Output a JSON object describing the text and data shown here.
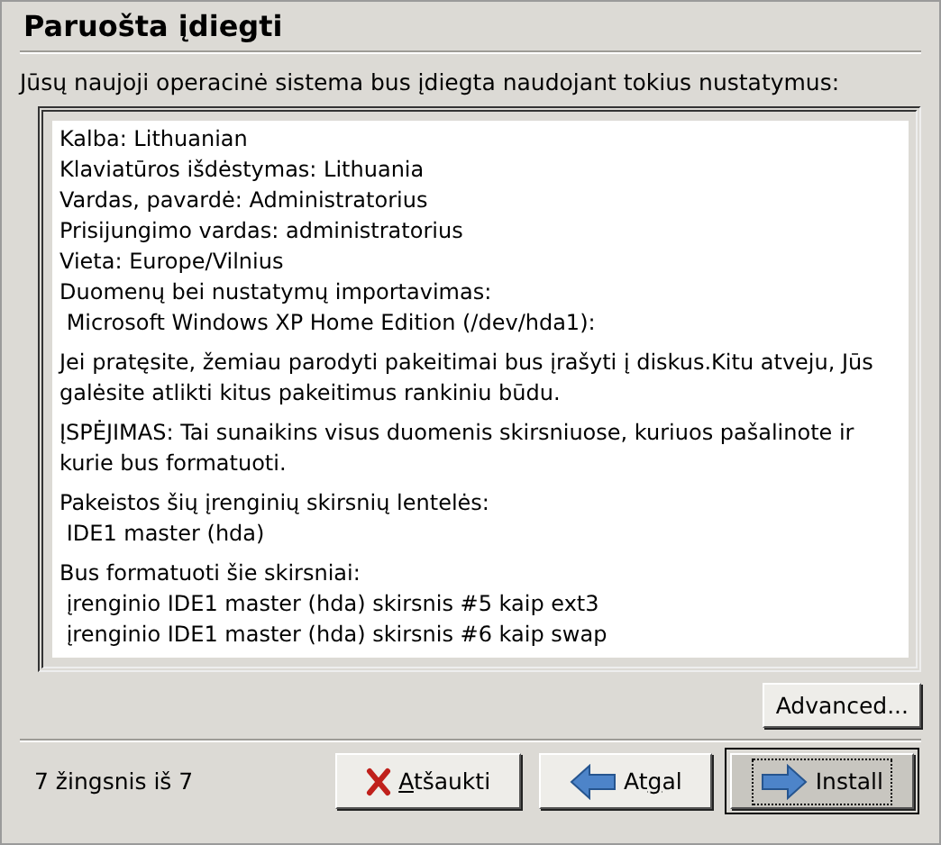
{
  "title": "Paruošta įdiegti",
  "intro": "Jūsų naujoji operacinė sistema bus įdiegta naudojant tokius nustatymus:",
  "summary": [
    {
      "lines": [
        "Kalba: Lithuanian",
        "Klaviatūros išdėstymas: Lithuania",
        "Vardas, pavardė: Administratorius",
        "Prisijungimo vardas: administratorius",
        "Vieta: Europe/Vilnius",
        "Duomenų bei nustatymų importavimas:",
        " Microsoft Windows XP Home Edition (/dev/hda1):"
      ]
    },
    {
      "lines": [
        "Jei pratęsite, žemiau parodyti pakeitimai bus įrašyti į diskus.Kitu atveju, Jūs galėsite atlikti kitus pakeitimus rankiniu būdu."
      ]
    },
    {
      "lines": [
        "ĮSPĖJIMAS: Tai sunaikins visus duomenis skirsniuose, kuriuos pašalinote ir kurie bus formatuoti."
      ]
    },
    {
      "lines": [
        "Pakeistos šių įrenginių skirsnių lentelės:",
        " IDE1 master (hda)"
      ]
    },
    {
      "lines": [
        "Bus formatuoti šie skirsniai:",
        " įrenginio IDE1 master (hda) skirsnis #5 kaip ext3",
        " įrenginio IDE1 master (hda) skirsnis #6 kaip swap"
      ]
    }
  ],
  "advanced_button": "Advanced...",
  "step": "7 žingsnis iš 7",
  "buttons": [
    {
      "kind": "cancel",
      "mnemonic": "A",
      "label_after": "tšaukti",
      "default": false
    },
    {
      "kind": "back",
      "label_before": "At",
      "mnemonic": "g",
      "label_after": "al",
      "default": false
    },
    {
      "kind": "forward",
      "label_before": "Install",
      "default": true
    }
  ]
}
